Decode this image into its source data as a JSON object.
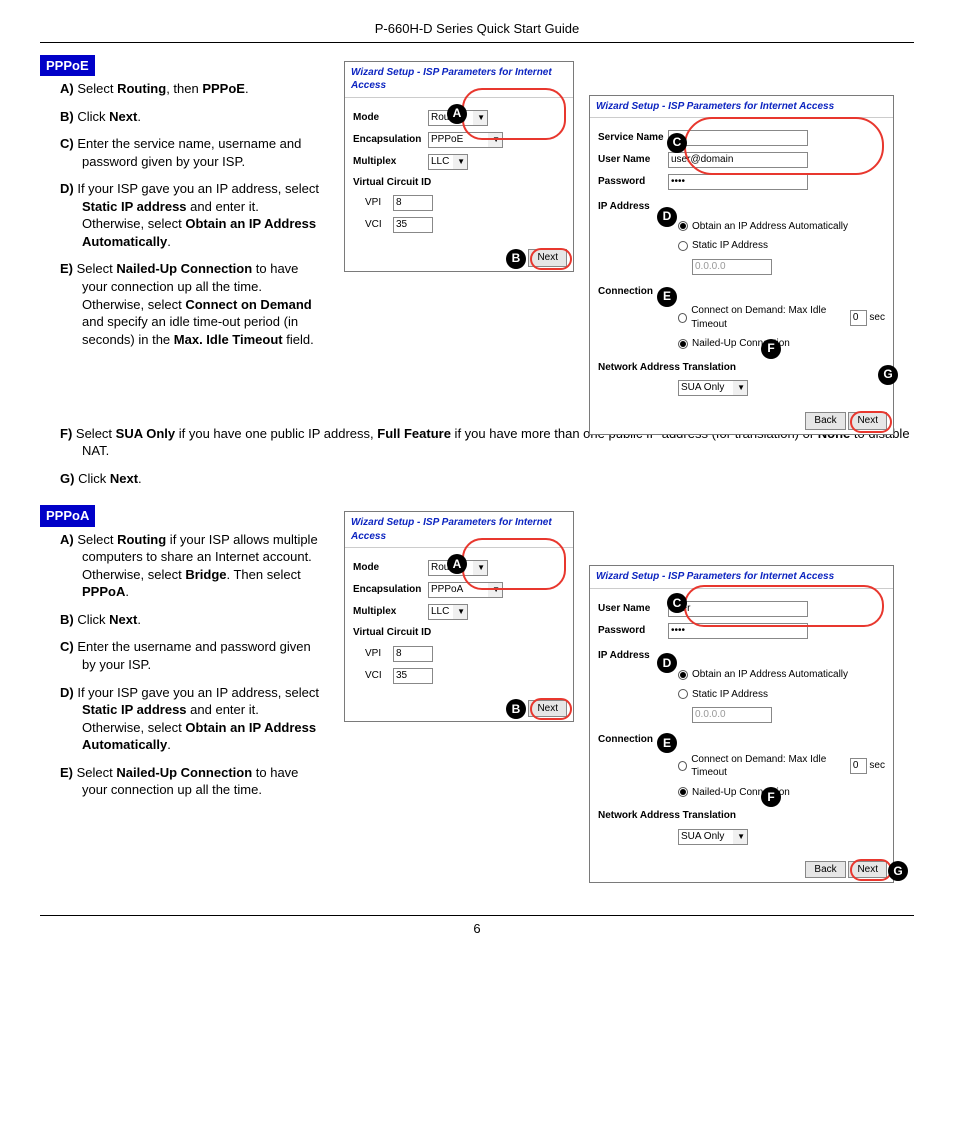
{
  "header": "P-660H-D Series Quick Start Guide",
  "page_number": "6",
  "pppoe": {
    "badge": "PPPoE",
    "steps": {
      "a": {
        "bullet": "A)",
        "t1": "Select ",
        "b1": "Routing",
        "t2": ", then ",
        "b2": "PPPoE",
        "t3": "."
      },
      "b": {
        "bullet": "B)",
        "t1": "Click ",
        "b1": "Next",
        "t2": "."
      },
      "c": {
        "bullet": "C)",
        "t1": "Enter the service name, username and password given by your ISP."
      },
      "d": {
        "bullet": "D)",
        "t1": "If your ISP gave you an IP address, select ",
        "b1": "Static IP address",
        "t2": " and enter it. Otherwise, select ",
        "b2": "Obtain an IP Address Automatically",
        "t3": "."
      },
      "e": {
        "bullet": "E)",
        "t1": "Select ",
        "b1": "Nailed-Up Connection",
        "t2": " to have your connection up all the time. Otherwise, select ",
        "b2": "Connect on Demand",
        "t3": " and specify an idle time-out period (in seconds) in the ",
        "b3": "Max. Idle Timeout",
        "t4": " field."
      },
      "f": {
        "bullet": "F)",
        "t1": "Select ",
        "b1": "SUA Only",
        "t2": " if you have one public IP address, ",
        "b2": "Full Feature",
        "t3": " if you have more than one public IP address (for translation) or ",
        "b3": "None",
        "t4": " to disable NAT."
      },
      "g": {
        "bullet": "G)",
        "t1": "Click ",
        "b1": "Next",
        "t2": "."
      }
    },
    "panel1": {
      "title": "Wizard Setup - ISP Parameters for Internet Access",
      "mode_label": "Mode",
      "mode_value": "Routing",
      "encap_label": "Encapsulation",
      "encap_value": "PPPoE",
      "multiplex_label": "Multiplex",
      "multiplex_value": "LLC",
      "vcid_label": "Virtual Circuit ID",
      "vpi_label": "VPI",
      "vpi_value": "8",
      "vci_label": "VCI",
      "vci_value": "35",
      "next_btn": "Next"
    },
    "panel2": {
      "title": "Wizard Setup - ISP Parameters for Internet Access",
      "svc_label": "Service Name",
      "svc_value": "",
      "user_label": "User Name",
      "user_value": "user@domain",
      "pwd_label": "Password",
      "pwd_value": "••••",
      "ip_label": "IP Address",
      "ip_auto": "Obtain an IP Address Automatically",
      "ip_static": "Static IP Address",
      "ip_value": "0.0.0.0",
      "conn_label": "Connection",
      "conn_demand": "Connect on Demand: Max Idle Timeout",
      "conn_demand_val": "0",
      "conn_sec": "sec",
      "conn_nailed": "Nailed-Up Connection",
      "nat_label": "Network Address Translation",
      "nat_value": "SUA Only",
      "back_btn": "Back",
      "next_btn": "Next"
    },
    "callouts": {
      "A": "A",
      "B": "B",
      "C": "C",
      "D": "D",
      "E": "E",
      "F": "F",
      "G": "G"
    }
  },
  "pppoa": {
    "badge": "PPPoA",
    "steps": {
      "a": {
        "bullet": "A)",
        "t1": "Select ",
        "b1": "Routing",
        "t2": " if your ISP allows multiple computers to share an Internet account. Otherwise, select ",
        "b2": "Bridge",
        "t3": ". Then select ",
        "b3": "PPPoA",
        "t4": "."
      },
      "b": {
        "bullet": "B)",
        "t1": "Click ",
        "b1": "Next",
        "t2": "."
      },
      "c": {
        "bullet": "C)",
        "t1": "Enter the username and password given by your ISP."
      },
      "d": {
        "bullet": "D)",
        "t1": "If your ISP gave you an IP address, select ",
        "b1": "Static IP address",
        "t2": " and enter it. Otherwise, select ",
        "b2": "Obtain an IP Address Automatically",
        "t3": "."
      },
      "e": {
        "bullet": "E)",
        "t1": "Select ",
        "b1": "Nailed-Up Connection",
        "t2": " to have your connection up all the time."
      }
    },
    "panel1": {
      "title": "Wizard Setup - ISP Parameters for Internet Access",
      "mode_label": "Mode",
      "mode_value": "Routing",
      "encap_label": "Encapsulation",
      "encap_value": "PPPoA",
      "multiplex_label": "Multiplex",
      "multiplex_value": "LLC",
      "vcid_label": "Virtual Circuit ID",
      "vpi_label": "VPI",
      "vpi_value": "8",
      "vci_label": "VCI",
      "vci_value": "35",
      "next_btn": "Next"
    },
    "panel2": {
      "title": "Wizard Setup - ISP Parameters for Internet Access",
      "user_label": "User Name",
      "user_value": "user",
      "pwd_label": "Password",
      "pwd_value": "••••",
      "ip_label": "IP Address",
      "ip_auto": "Obtain an IP Address Automatically",
      "ip_static": "Static IP Address",
      "ip_value": "0.0.0.0",
      "conn_label": "Connection",
      "conn_demand": "Connect on Demand: Max Idle Timeout",
      "conn_demand_val": "0",
      "conn_sec": "sec",
      "conn_nailed": "Nailed-Up Connection",
      "nat_label": "Network Address Translation",
      "nat_value": "SUA Only",
      "back_btn": "Back",
      "next_btn": "Next"
    },
    "callouts": {
      "A": "A",
      "B": "B",
      "C": "C",
      "D": "D",
      "E": "E",
      "F": "F",
      "G": "G"
    }
  }
}
